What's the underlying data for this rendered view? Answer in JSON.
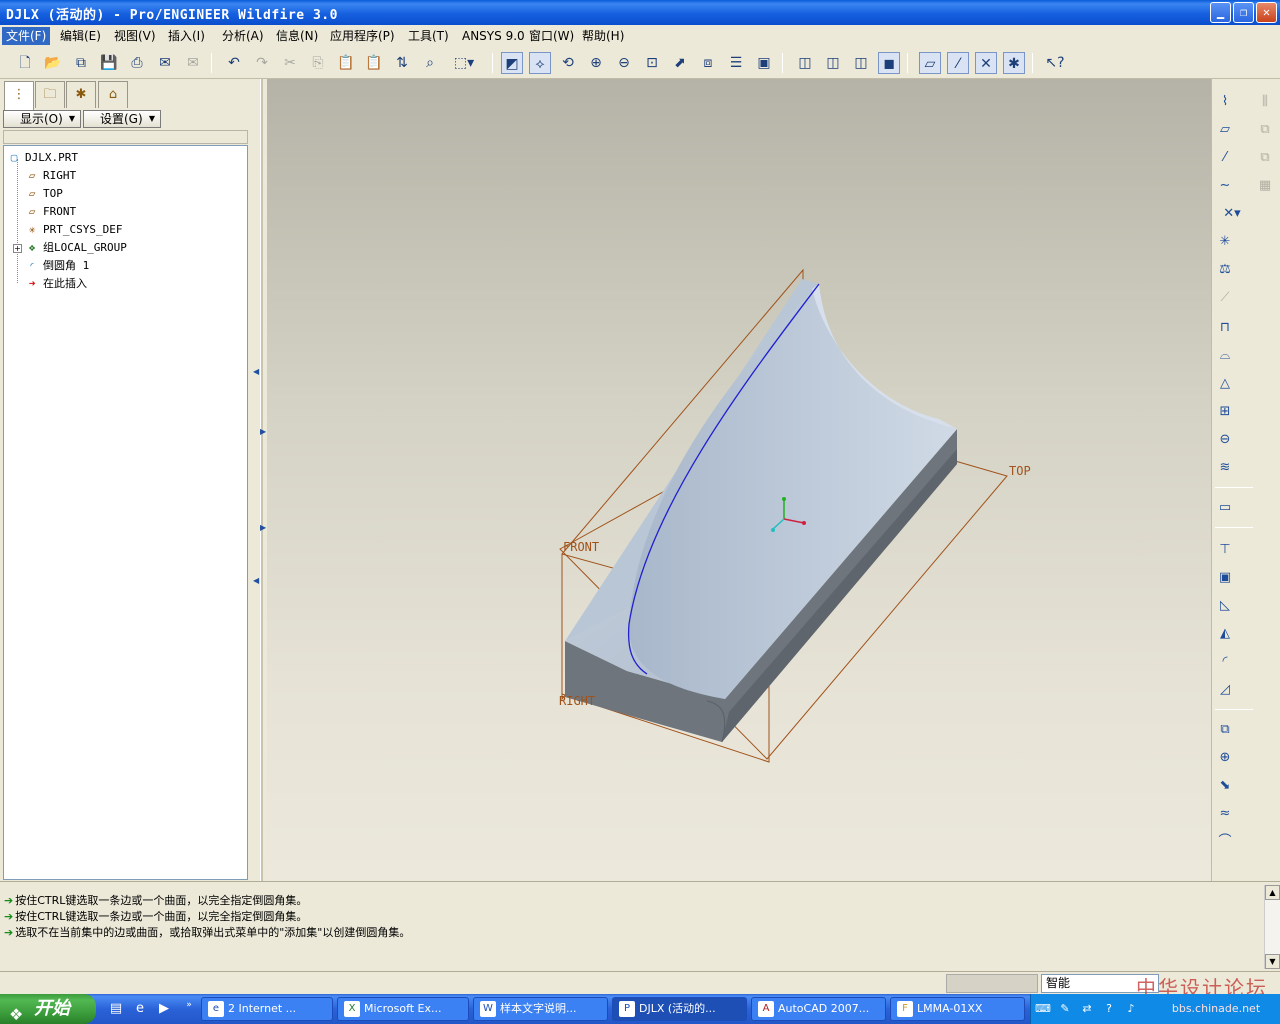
{
  "window": {
    "title": "DJLX (活动的) - Pro/ENGINEER Wildfire 3.0"
  },
  "menu": [
    "文件(F)",
    "编辑(E)",
    "视图(V)",
    "插入(I)",
    "分析(A)",
    "信息(N)",
    "应用程序(P)",
    "工具(T)",
    "ANSYS 9.0",
    "窗口(W)",
    "帮助(H)"
  ],
  "navigator": {
    "show_button": "显示(O)",
    "settings_button": "设置(G)"
  },
  "model_tree": [
    {
      "label": "DJLX.PRT",
      "icon": "part-icon"
    },
    {
      "label": "RIGHT",
      "icon": "datum-plane-icon"
    },
    {
      "label": "TOP",
      "icon": "datum-plane-icon"
    },
    {
      "label": "FRONT",
      "icon": "datum-plane-icon"
    },
    {
      "label": "PRT_CSYS_DEF",
      "icon": "csys-icon"
    },
    {
      "label": "组LOCAL_GROUP",
      "icon": "group-icon"
    },
    {
      "label": "倒圆角 1",
      "icon": "round-icon"
    },
    {
      "label": "在此插入",
      "icon": "insert-here-icon"
    }
  ],
  "graphics": {
    "datum_labels": {
      "top": "TOP",
      "front": "FRONT",
      "right": "RIGHT"
    }
  },
  "messages": [
    "按住CTRL键选取一条边或一个曲面，以完全指定倒圆角集。",
    "按住CTRL键选取一条边或一个曲面，以完全指定倒圆角集。",
    "选取不在当前集中的边或曲面，或拾取弹出式菜单中的\"添加集\"以创建倒圆角集。"
  ],
  "status": {
    "filter_value": "智能"
  },
  "watermark": {
    "line1": "中华设计论坛",
    "line2": "bbs.chinade.net"
  },
  "taskbar": {
    "start_label": "开始",
    "tasks": [
      {
        "label": "2 Internet ...",
        "icon": "e"
      },
      {
        "label": "Microsoft Ex...",
        "icon": "X"
      },
      {
        "label": "样本文字说明...",
        "icon": "W"
      },
      {
        "label": "DJLX (活动的...",
        "icon": "P"
      },
      {
        "label": "AutoCAD 2007...",
        "icon": "A"
      },
      {
        "label": "LMMA-01XX",
        "icon": "F"
      }
    ]
  },
  "colors": {
    "titlebar": "#0a5ad8",
    "menu_active": "#316ac5",
    "datum": "#a0521a",
    "part_surface": "#b9c6d6",
    "part_side": "#6f757c",
    "highlight_edge": "#2020d0"
  }
}
